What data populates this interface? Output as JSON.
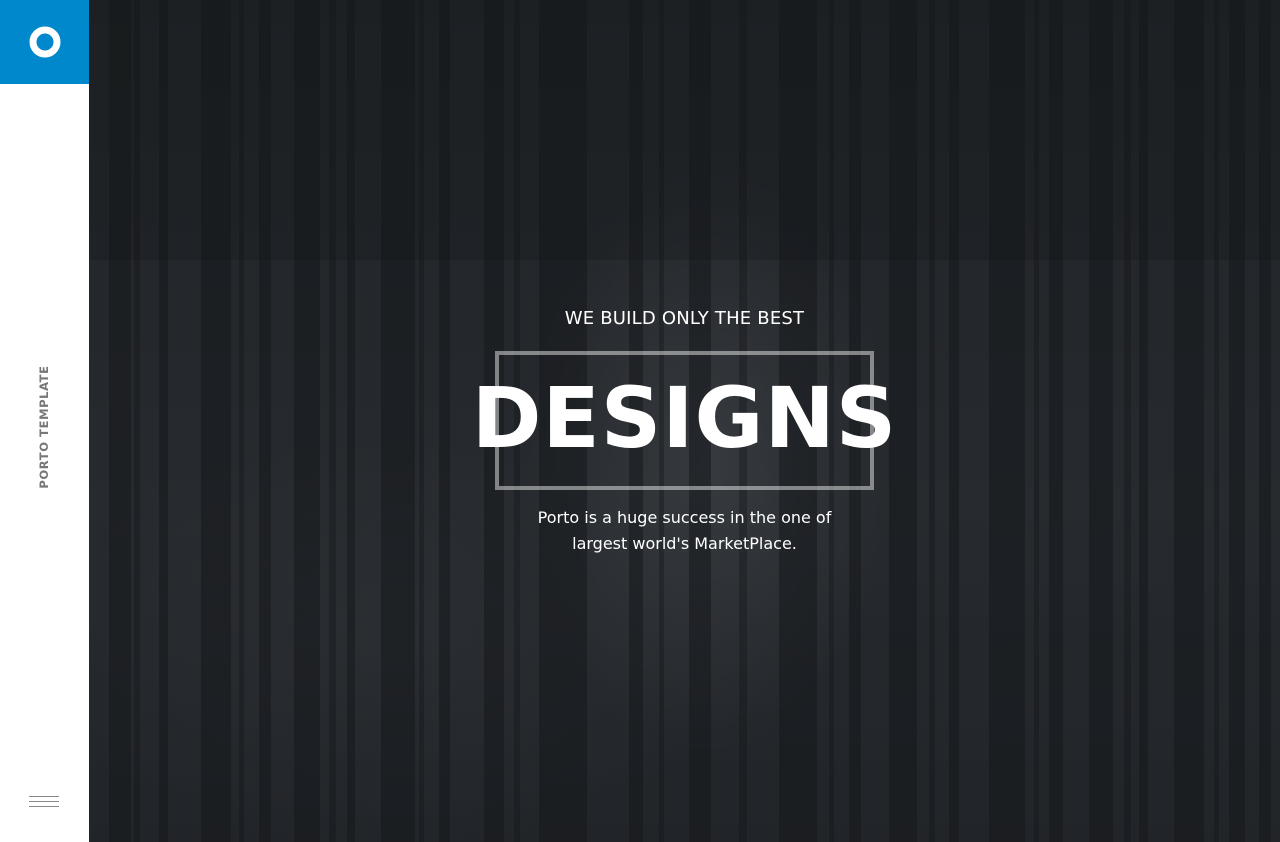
{
  "sidebar": {
    "logo_icon": "ring-logo-icon",
    "vertical_label": "PORTO TEMPLATE",
    "menu_icon": "hamburger-menu-icon"
  },
  "hero": {
    "tagline": "WE BUILD ONLY THE BEST",
    "title": "DESIGNS",
    "subtitle_line1": "Porto is a huge success in the one of",
    "subtitle_line2": "largest world's MarketPlace."
  },
  "colors": {
    "accent": "#0088cc",
    "sidebar_bg": "#ffffff",
    "hero_bg": "#24272b",
    "text_light": "#ffffff",
    "label_gray": "#777777"
  }
}
